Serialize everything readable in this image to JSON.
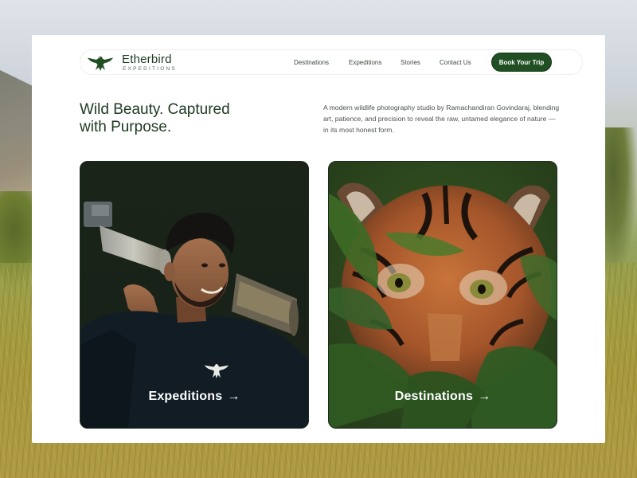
{
  "brand": {
    "name": "Etherbird",
    "tagline": "EXPEDITIONS",
    "accent_color": "#1f4f22",
    "logo_icon": "bird-icon"
  },
  "nav": {
    "links": [
      "Destinations",
      "Expeditions",
      "Stories",
      "Contact Us"
    ],
    "cta_label": "Book Your Trip"
  },
  "hero": {
    "headline_line1": "Wild Beauty. Captured",
    "headline_line2": "with Purpose.",
    "intro": "A modern wildlife photography studio by Ramachandiran Govindaraj, blending art, patience, and precision to reveal the raw, untamed elegance of nature — in its most honest form."
  },
  "tiles": [
    {
      "label": "Expeditions",
      "arrow": "→",
      "image": "photographer-with-telephoto-lens"
    },
    {
      "label": "Destinations",
      "arrow": "→",
      "image": "tiger-in-foliage"
    }
  ]
}
